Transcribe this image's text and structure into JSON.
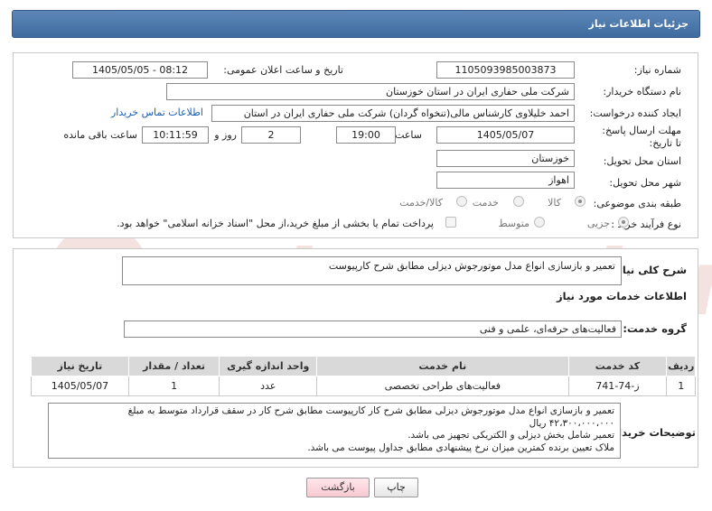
{
  "header": {
    "title": "جزئیات اطلاعات نیاز"
  },
  "fields": {
    "need_number_label": "شماره نیاز:",
    "need_number": "1105093985003873",
    "announce_label": "تاریخ و ساعت اعلان عمومی:",
    "announce_value": "1405/05/05 - 08:12",
    "buyer_org_label": "نام دستگاه خریدار:",
    "buyer_org": "شرکت ملی حفاری ایران در استان خوزستان",
    "requester_label": "ایجاد کننده درخواست:",
    "requester": "احمد خلیلاوی کارشناس مالی(تنخواه گردان) شرکت ملی حفاری ایران در استان",
    "contact_link": "اطلاعات تماس خریدار",
    "deadline_label": "مهلت ارسال پاسخ: تا تاریخ:",
    "deadline_date": "1405/05/07",
    "time_label": "ساعت",
    "deadline_time": "19:00",
    "days_value": "2",
    "days_label": "روز و",
    "remaining_time": "10:11:59",
    "remaining_label": "ساعت باقی مانده",
    "province_label": "استان محل تحویل:",
    "province": "خوزستان",
    "city_label": "شهر محل تحویل:",
    "city": "اهواز",
    "category_label": "طبقه بندی موضوعی:",
    "category_options": [
      "کالا",
      "خدمت",
      "کالا/خدمت"
    ],
    "purchase_type_label": "نوع فرآیند خرید :",
    "purchase_options": [
      "جزیی",
      "متوسط"
    ],
    "payment_note": "پرداخت تمام یا بخشی از مبلغ خرید،از محل \"اسناد خزانه اسلامی\" خواهد بود."
  },
  "summary": {
    "label": "شرح کلی نیاز:",
    "value": "تعمیر و بازسازی انواع مدل موتورجوش دیزلی مطابق شرح کارپیوست"
  },
  "services": {
    "section_title": "اطلاعات خدمات مورد نیاز",
    "group_label": "گروه خدمت:",
    "group_value": "فعالیت‌های حرفه‌ای، علمی و فنی",
    "columns": [
      "ردیف",
      "کد خدمت",
      "نام خدمت",
      "واحد اندازه گیری",
      "تعداد / مقدار",
      "تاریخ نیاز"
    ],
    "rows": [
      [
        "1",
        "ز-74-741",
        "فعالیت‌های طراحی تخصصی",
        "عدد",
        "1",
        "1405/05/07"
      ]
    ]
  },
  "buyer_notes": {
    "label": "توضیحات خریدار:",
    "lines": [
      "تعمیر و بازسازی انواع مدل موتورجوش دیزلی مطابق شرح کار کارپیوست مطابق شرح کار در سقف قرارداد متوسط به مبلغ",
      "۴۲،۳۰۰،۰۰۰،۰۰۰ ریال",
      "تعمیر شامل بخش دیزلی و الکتریکی تجهیز می باشد.",
      "ملاک تعیین برنده کمترین میزان نرخ پیشنهادی مطابق جداول  پیوست می باشد."
    ]
  },
  "buttons": {
    "print": "چاپ",
    "back": "بازگشت"
  },
  "watermark": {
    "text": "AriaTender.neT"
  },
  "colors": {
    "header": "#4a77ab",
    "link": "#1a5fb4",
    "back_button": "#f7c9d1"
  }
}
